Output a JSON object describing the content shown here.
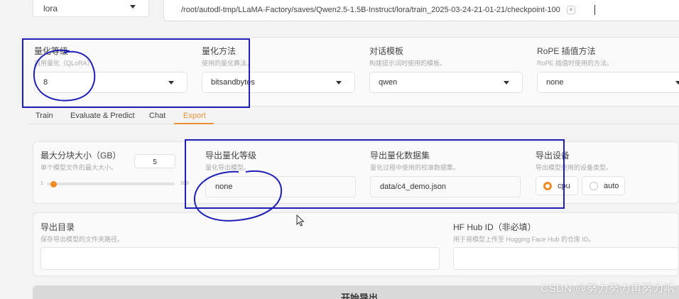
{
  "top": {
    "adapter_value": "lora",
    "checkpoint_tag": "/root/autodl-tmp/LLaMA-Factory/saves/Qwen2.5-1.5B-Instruct/lora/train_2025-03-24-21-01-21/checkpoint-100",
    "remove_glyph": "×"
  },
  "quant": {
    "bit": {
      "label": "量化等级",
      "desc": "启用量化（QLoRA）",
      "value": "8"
    },
    "method": {
      "label": "量化方法",
      "desc": "使用的量化算法。",
      "value": "bitsandbytes"
    },
    "template": {
      "label": "对话模板",
      "desc": "构建提示词时使用的模板。",
      "value": "qwen"
    },
    "rope": {
      "label": "RoPE 插值方法",
      "desc": "RoPE 插值时使用的方法。",
      "value": "none"
    }
  },
  "tabs": [
    {
      "label": "Train"
    },
    {
      "label": "Evaluate & Predict"
    },
    {
      "label": "Chat"
    },
    {
      "label": "Export"
    }
  ],
  "export": {
    "shard": {
      "label": "最大分块大小（GB）",
      "desc": "单个模型文件的最大大小。",
      "value": "5",
      "min": "1",
      "max": "100",
      "level": 0.04
    },
    "quant_bit": {
      "label": "导出量化等级",
      "desc": "量化导出模型。",
      "value": "none"
    },
    "dataset": {
      "label": "导出量化数据集",
      "desc": "量化过程中使用的校准数据集。",
      "value": "data/c4_demo.json"
    },
    "device": {
      "label": "导出设备",
      "desc": "导出模型使用的设备类型。",
      "options": [
        "cpu",
        "auto"
      ],
      "selected": "cpu"
    },
    "dir": {
      "label": "导出目录",
      "desc": "保存导出模型的文件夹路径。",
      "value": ""
    },
    "hub": {
      "label": "HF Hub ID（非必填）",
      "desc": "用于将模型上传至 Hugging Face Hub 的仓库 ID。",
      "value": ""
    },
    "button_label": "开始导出"
  },
  "watermark": "CSDN @努力努力再努力呐",
  "colors": {
    "accent": "#f08a24",
    "annotation": "#1f1fb8"
  }
}
